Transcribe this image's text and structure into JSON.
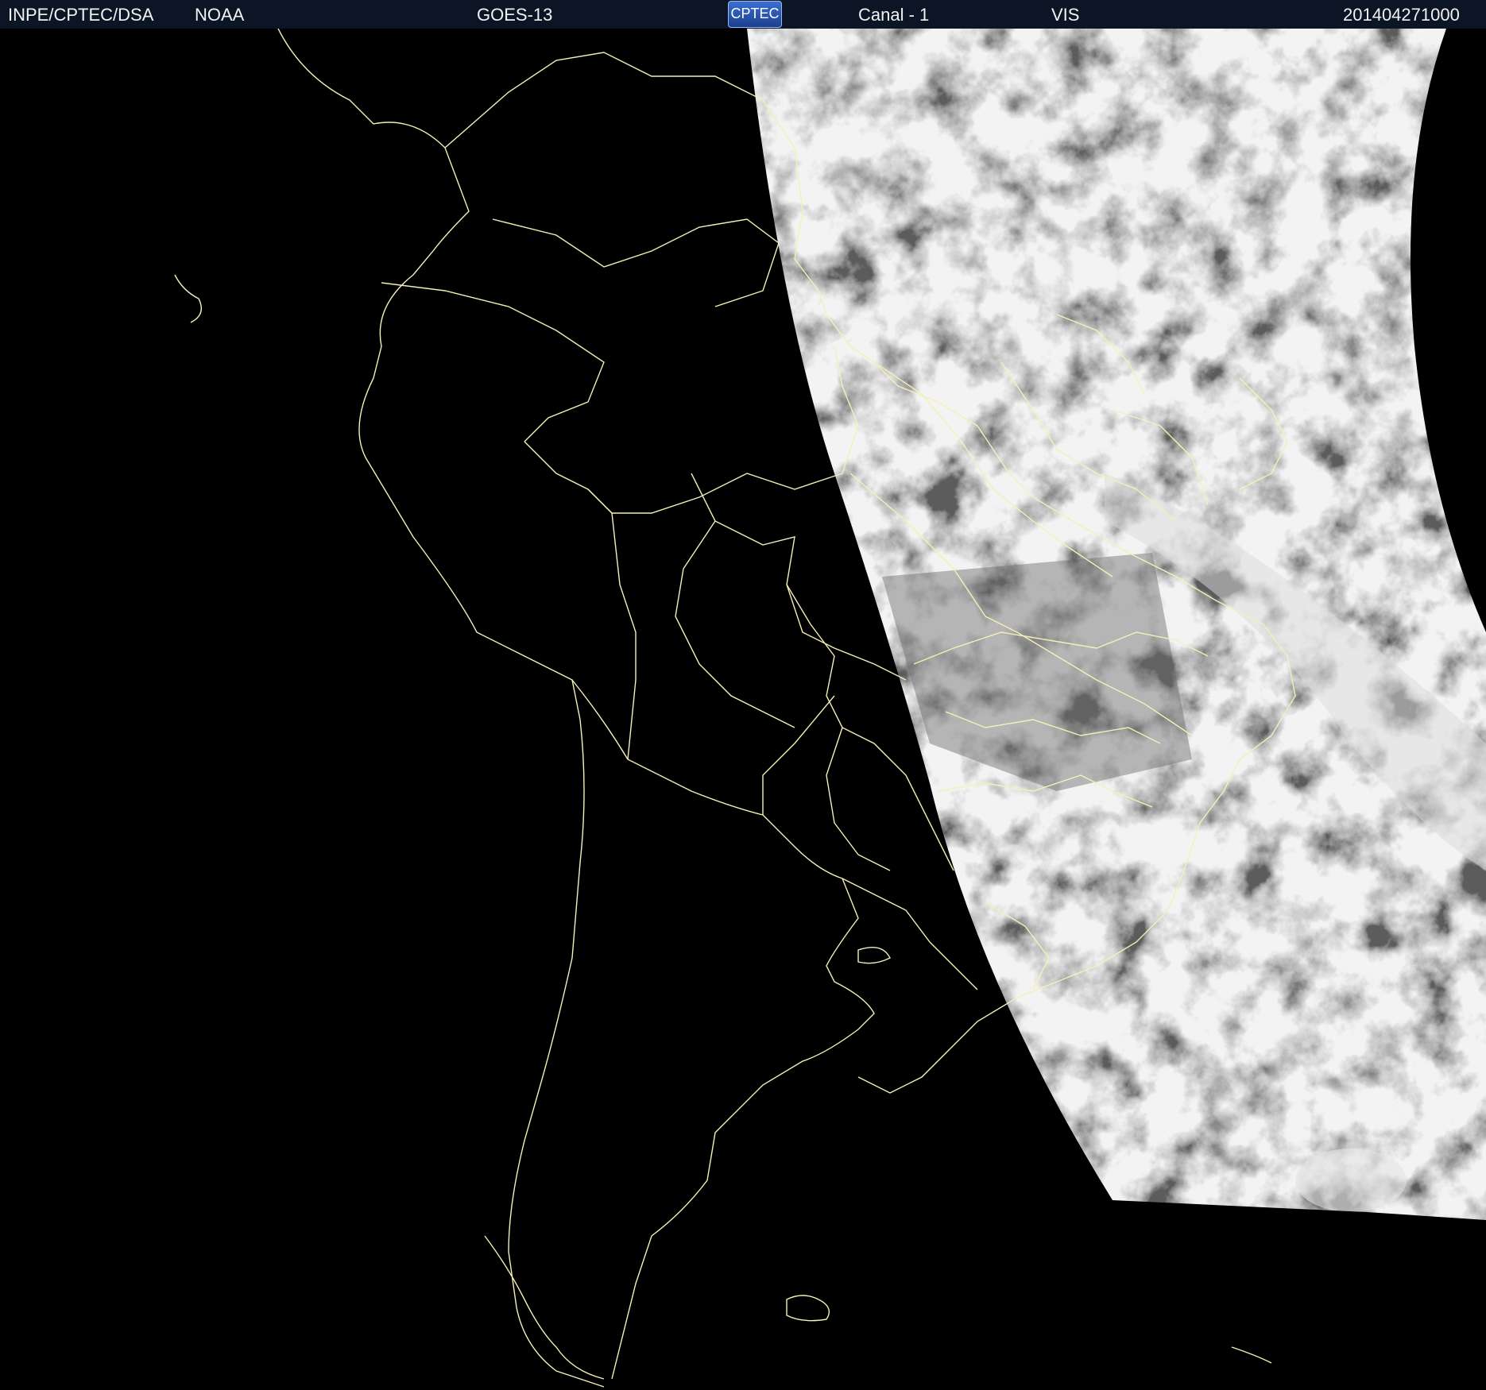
{
  "header": {
    "source": "INPE/CPTEC/DSA",
    "agency": "NOAA",
    "satellite": "GOES-13",
    "logo_text": "CPTEC",
    "channel": "Canal - 1",
    "band": "VIS",
    "timestamp": "201404271000"
  },
  "colors": {
    "header_background": "#0b1526",
    "header_text": "#f2f2f2",
    "map_background": "#000000",
    "boundary_lines": "#f4f0b8",
    "cloud_gray": "#8a8a8a"
  },
  "icons": {
    "logo": "cptec-logo"
  }
}
